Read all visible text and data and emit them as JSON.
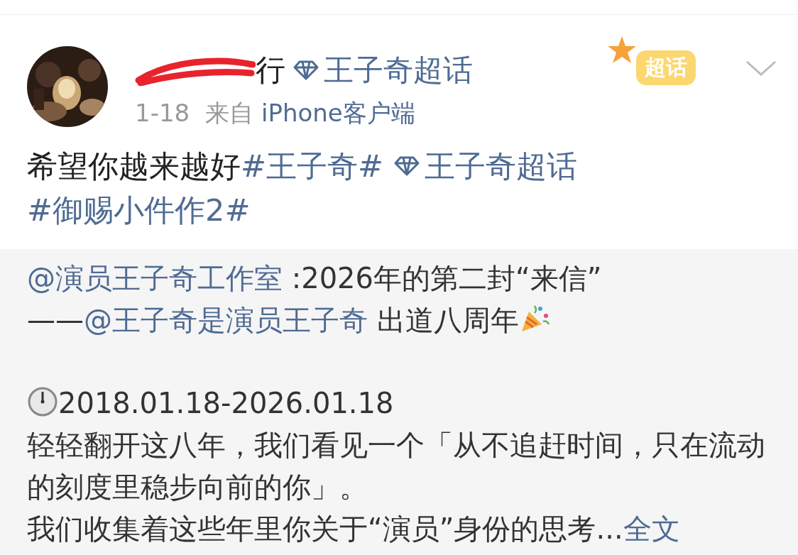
{
  "post": {
    "author": {
      "name": "行",
      "redacted": true
    },
    "super_topic": "王子奇超话",
    "badge": "超话",
    "time": "1-18",
    "source_prefix": "来自",
    "source": "iPhone客户端",
    "body": [
      {
        "kind": "text",
        "text": "希望你越来越好"
      },
      {
        "kind": "topic",
        "text": "#王子奇#"
      },
      {
        "kind": "supertopic",
        "text": "王子奇超话"
      },
      {
        "kind": "topic",
        "text": "#御赐小件作2#"
      }
    ]
  },
  "repost": {
    "paragraphs": [
      {
        "kind": "plain",
        "segments": [
          {
            "kind": "mention",
            "text": "@演员王子奇工作室"
          },
          {
            "kind": "text",
            "text": " :2026年的第二封“来信”"
          }
        ]
      },
      {
        "kind": "celebration",
        "segments": [
          {
            "kind": "text",
            "text": "——"
          },
          {
            "kind": "mention",
            "text": "@王子奇是演员王子奇"
          },
          {
            "kind": "text",
            "text": " 出道八周年"
          }
        ]
      },
      {
        "kind": "date",
        "segments": [
          {
            "kind": "text",
            "text": "2018.01.18-2026.01.18"
          }
        ]
      },
      {
        "kind": "plain",
        "segments": [
          {
            "kind": "text",
            "text": "轻轻翻开这八年，我们看见一个「从不追赶时间，只在流动的刻度里稳步向前的你」。"
          }
        ]
      },
      {
        "kind": "plain",
        "segments": [
          {
            "kind": "text",
            "text": "我们收集着这些年里你关于“演员”身份的思考..."
          },
          {
            "kind": "link",
            "text": "全文"
          }
        ]
      }
    ]
  }
}
